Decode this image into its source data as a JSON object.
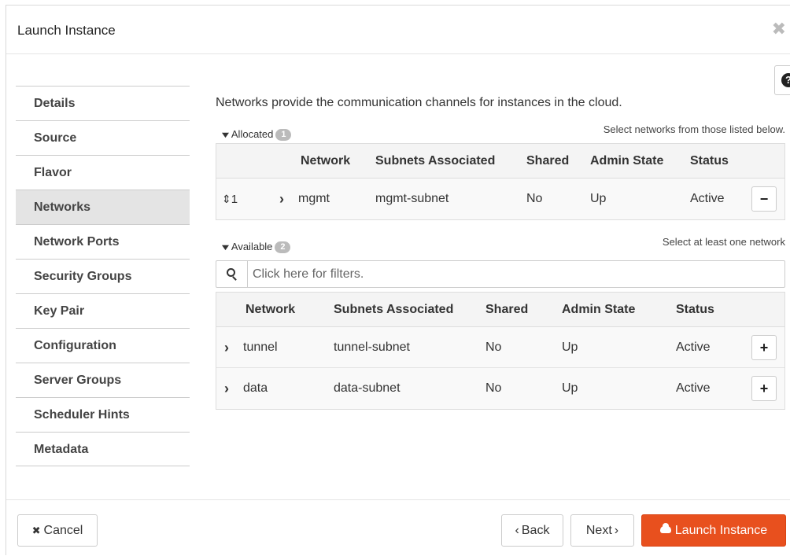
{
  "dialog": {
    "title": "Launch Instance",
    "close_glyph": "✖"
  },
  "help_glyph": "?",
  "wizard_nav": {
    "items": [
      {
        "label": "Details"
      },
      {
        "label": "Source"
      },
      {
        "label": "Flavor"
      },
      {
        "label": "Networks"
      },
      {
        "label": "Network Ports"
      },
      {
        "label": "Security Groups"
      },
      {
        "label": "Key Pair"
      },
      {
        "label": "Configuration"
      },
      {
        "label": "Server Groups"
      },
      {
        "label": "Scheduler Hints"
      },
      {
        "label": "Metadata"
      }
    ],
    "active": "Networks"
  },
  "networks": {
    "intro": "Networks provide the communication channels for instances in the cloud.",
    "allocated": {
      "label": "Allocated",
      "count": "1",
      "hint": "Select networks from those listed below.",
      "columns": {
        "network": "Network",
        "subnets": "Subnets Associated",
        "shared": "Shared",
        "admin_state": "Admin State",
        "status": "Status"
      },
      "rows": [
        {
          "order": "1",
          "network": "mgmt",
          "subnets": "mgmt-subnet",
          "shared": "No",
          "admin_state": "Up",
          "status": "Active",
          "action_glyph": "−"
        }
      ]
    },
    "available": {
      "label": "Available",
      "count": "2",
      "hint": "Select at least one network",
      "filter_placeholder": "Click here for filters.",
      "columns": {
        "network": "Network",
        "subnets": "Subnets Associated",
        "shared": "Shared",
        "admin_state": "Admin State",
        "status": "Status"
      },
      "rows": [
        {
          "network": "tunnel",
          "subnets": "tunnel-subnet",
          "shared": "No",
          "admin_state": "Up",
          "status": "Active",
          "action_glyph": "+"
        },
        {
          "network": "data",
          "subnets": "data-subnet",
          "shared": "No",
          "admin_state": "Up",
          "status": "Active",
          "action_glyph": "+"
        }
      ]
    }
  },
  "footer": {
    "cancel_label": "Cancel",
    "cancel_glyph": "✖",
    "back_label": "Back",
    "back_glyph": "‹",
    "next_label": "Next",
    "next_glyph": "›",
    "launch_label": "Launch Instance"
  },
  "colors": {
    "launch_button": "#e8501e",
    "active_nav_bg": "#e4e4e4",
    "badge": "#bbbbbb"
  }
}
